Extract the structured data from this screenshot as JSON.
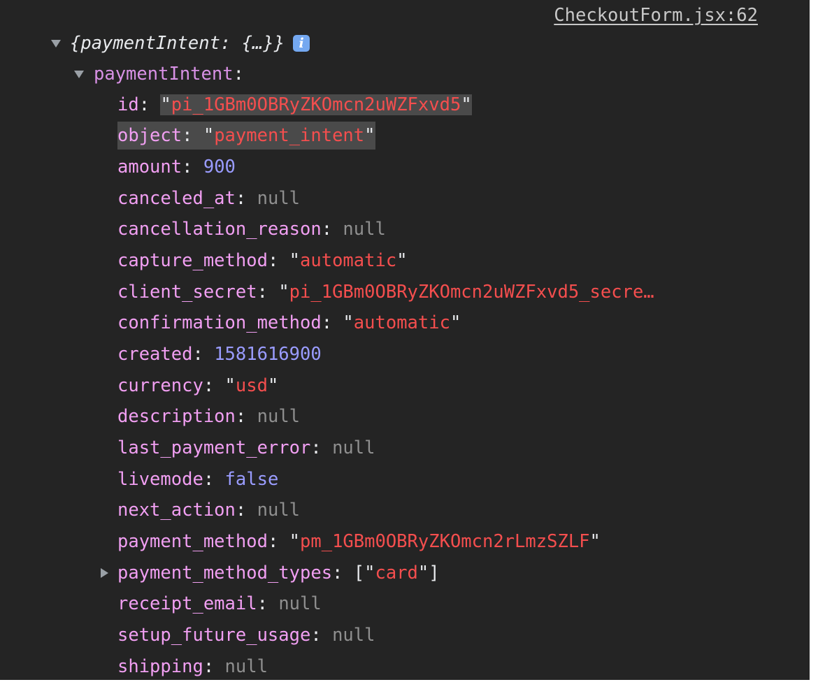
{
  "source_link": "CheckoutForm.jsx:62",
  "summary": "{paymentIntent: {…}}",
  "info_icon_glyph": "i",
  "object_name": "paymentIntent",
  "colon": ":",
  "quote": "\"",
  "properties": {
    "id": {
      "key": "id",
      "value": "pi_1GBm0OBRyZKOmcn2uWZFxvd5"
    },
    "object": {
      "key": "object",
      "value": "payment_intent"
    },
    "amount": {
      "key": "amount",
      "value": "900"
    },
    "canceled_at": {
      "key": "canceled_at",
      "value": "null"
    },
    "cancellation_reason": {
      "key": "cancellation_reason",
      "value": "null"
    },
    "capture_method": {
      "key": "capture_method",
      "value": "automatic"
    },
    "client_secret": {
      "key": "client_secret",
      "value": "pi_1GBm0OBRyZKOmcn2uWZFxvd5_secre…"
    },
    "confirmation_method": {
      "key": "confirmation_method",
      "value": "automatic"
    },
    "created": {
      "key": "created",
      "value": "1581616900"
    },
    "currency": {
      "key": "currency",
      "value": "usd"
    },
    "description": {
      "key": "description",
      "value": "null"
    },
    "last_payment_error": {
      "key": "last_payment_error",
      "value": "null"
    },
    "livemode": {
      "key": "livemode",
      "value": "false"
    },
    "next_action": {
      "key": "next_action",
      "value": "null"
    },
    "payment_method": {
      "key": "payment_method",
      "value": "pm_1GBm0OBRyZKOmcn2rLmzSZLF"
    },
    "payment_method_types": {
      "key": "payment_method_types",
      "open": "[",
      "value": "card",
      "close": "]"
    },
    "receipt_email": {
      "key": "receipt_email",
      "value": "null"
    },
    "setup_future_usage": {
      "key": "setup_future_usage",
      "value": "null"
    },
    "shipping": {
      "key": "shipping",
      "value": "null"
    }
  },
  "colors": {
    "background": "#242424",
    "key": "#f19ff2",
    "string": "#f44e4e",
    "number": "#9a9cff",
    "null": "#8f8f8f",
    "info_badge": "#74a8f0"
  }
}
